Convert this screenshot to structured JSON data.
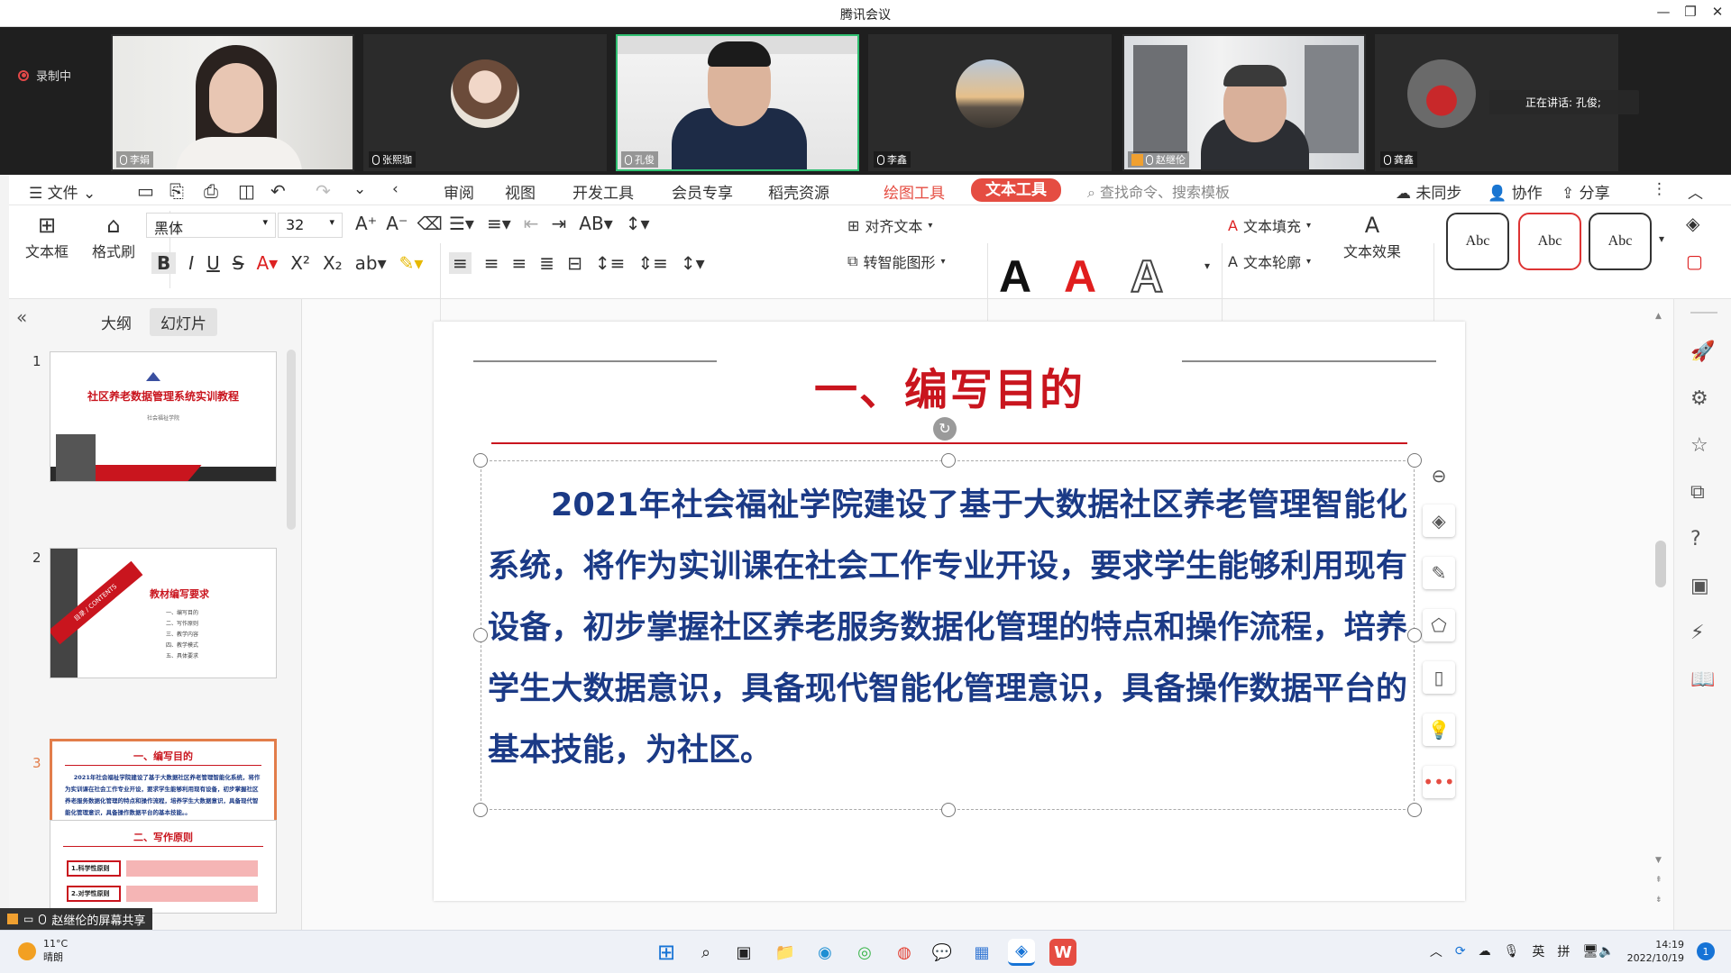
{
  "meeting": {
    "title": "腾讯会议",
    "recording_label": "录制中",
    "speaking_label": "正在讲话: 孔俊;",
    "participants": [
      {
        "name": "李娟"
      },
      {
        "name": "张熙珈"
      },
      {
        "name": "孔俊"
      },
      {
        "name": "李鑫"
      },
      {
        "name": "赵继伦"
      },
      {
        "name": "龚鑫"
      }
    ],
    "share_label": "赵继伦的屏幕共享"
  },
  "menubar": {
    "file": "文件",
    "tabs": [
      "审阅",
      "视图",
      "开发工具",
      "会员专享",
      "稻壳资源"
    ],
    "drawing_tools": "绘图工具",
    "text_tools": "文本工具",
    "search": "查找命令、搜索模板",
    "unsynced": "未同步",
    "collab": "协作",
    "share": "分享"
  },
  "ribbon": {
    "textbox": "文本框",
    "format_painter": "格式刷",
    "font_name": "黑体",
    "font_size": "32",
    "align_text": "对齐文本",
    "smart_shape": "转智能图形",
    "text_fill": "文本填充",
    "text_outline": "文本轮廓",
    "text_effect": "文本效果",
    "style_sample": "Abc",
    "art_letter": "A"
  },
  "panel": {
    "tab_outline": "大纲",
    "tab_slides": "幻灯片",
    "thumbs": [
      {
        "num": "1",
        "title": "社区养老数据管理系统实训教程",
        "sub": "社会福祉学院"
      },
      {
        "num": "2",
        "title": "教材编写要求",
        "band": "目录 / CONTENTS",
        "items": [
          "一、编写目的",
          "二、写作原则",
          "三、教学内容",
          "四、教学模式",
          "五、具体要求"
        ]
      },
      {
        "num": "3",
        "title": "一、编写目的",
        "text": "2021年社会福祉学院建设了基于大数据社区养老管理智能化系统，将作为实训课在社会工作专业开设，要求学生能够利用现有设备，初步掌握社区养老服务数据化管理的特点和操作流程，培养学生大数据意识，具备现代智能化管理意识，具备操作数据平台的基本技能。。"
      },
      {
        "num": "4",
        "title": "二、写作原则",
        "rows": [
          "1.科学性原则",
          "2.对学性原则"
        ]
      }
    ]
  },
  "slide": {
    "title": "一、编写目的",
    "body": "2021年社会福祉学院建设了基于大数据社区养老管理智能化系统，将作为实训课在社会工作专业开设，要求学生能够利用现有设备，初步掌握社区养老服务数据化管理的特点和操作流程，培养学生大数据意识，具备现代智能化管理意识，具备操作数据平台的基本技能，为社区。"
  },
  "taskbar": {
    "temperature": "11°C",
    "weather": "晴朗",
    "ime_lang": "英",
    "ime_mode": "拼",
    "time": "14:19",
    "date": "2022/10/19",
    "notifications": "1"
  },
  "colors": {
    "accent_red": "#e54d42",
    "title_red": "#c9151e",
    "body_blue": "#1b3a86",
    "active_speaker": "#2fbf71"
  }
}
